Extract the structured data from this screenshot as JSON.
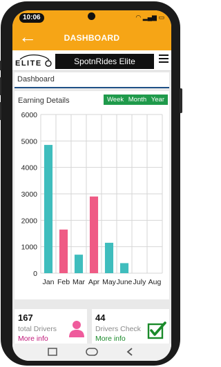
{
  "status_bar": {
    "time": "10:06"
  },
  "app_bar": {
    "title": "DASHBOARD"
  },
  "brand": {
    "logo_text": "ELITE",
    "name": "SpotnRides Elite"
  },
  "breadcrumb": "Dashboard",
  "earnings": {
    "title": "Earning Details",
    "periods": [
      "Week",
      "Month",
      "Year"
    ]
  },
  "chart_data": {
    "type": "bar",
    "categories": [
      "Jan",
      "Feb",
      "Mar",
      "Apr",
      "May",
      "June",
      "July",
      "Aug"
    ],
    "values": [
      4850,
      1650,
      700,
      2900,
      1150,
      380,
      0,
      0
    ],
    "bar_colors": [
      "#3fbdbd",
      "#ef5b85",
      "#3fbdbd",
      "#ef5b85",
      "#3fbdbd",
      "#3fbdbd",
      "#3fbdbd",
      "#3fbdbd"
    ],
    "yticks": [
      0,
      1000,
      2000,
      3000,
      4000,
      5000,
      6000
    ],
    "ylim": [
      0,
      6000
    ],
    "grid": true
  },
  "stats": [
    {
      "value": "167",
      "label": "total Drivers",
      "link": "More info",
      "link_color": "#c0187a",
      "icon": "person-icon"
    },
    {
      "value": "44",
      "label": "Drivers Check",
      "link": "More info",
      "link_color": "#1a8a2a",
      "icon": "checkbox-icon"
    }
  ],
  "colors": {
    "accent": "#f6a516",
    "header_rule": "#1e4f86",
    "tab_green": "#1f9a4b"
  }
}
